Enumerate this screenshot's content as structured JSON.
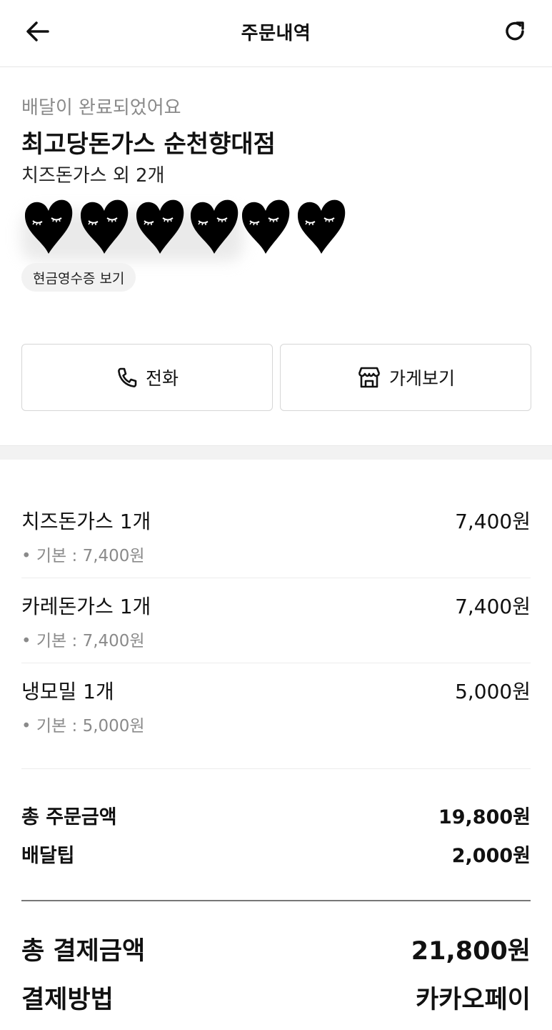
{
  "header": {
    "title": "주문내역",
    "back_icon": "arrow-left-icon",
    "refresh_icon": "refresh-icon"
  },
  "order": {
    "status": "배달이 완료되었어요",
    "store_name": "최고당돈가스 순천향대점",
    "summary": "치즈돈가스 외 2개",
    "receipt_button": "현금영수증 보기"
  },
  "actions": {
    "call_label": "전화",
    "store_label": "가게보기"
  },
  "items": [
    {
      "name": "치즈돈가스 1개",
      "price": "7,400원",
      "option": "• 기본 : 7,400원"
    },
    {
      "name": "카레돈가스 1개",
      "price": "7,400원",
      "option": "• 기본 : 7,400원"
    },
    {
      "name": "냉모밀 1개",
      "price": "5,000원",
      "option": "• 기본 : 5,000원"
    }
  ],
  "totals": {
    "order_total_label": "총 주문금액",
    "order_total_value": "19,800원",
    "delivery_tip_label": "배달팁",
    "delivery_tip_value": "2,000원",
    "payment_total_label": "총 결제금액",
    "payment_total_value": "21,800원",
    "payment_method_label": "결제방법",
    "payment_method_value": "카카오페이"
  },
  "colors": {
    "muted_text": "#8a8a8a",
    "border": "#d6d6d6",
    "band": "#f2f2f2"
  }
}
